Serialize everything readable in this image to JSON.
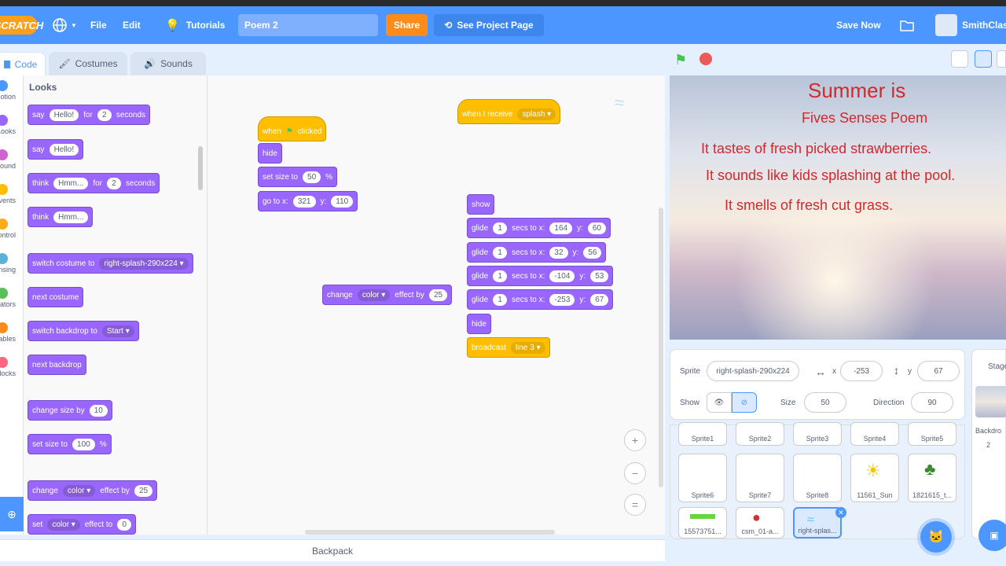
{
  "menu": {
    "logo": "SCRATCH",
    "file": "File",
    "edit": "Edit",
    "tutorials": "Tutorials",
    "project_title": "Poem 2",
    "share": "Share",
    "see_project": "See Project Page",
    "save_now": "Save Now",
    "username": "SmithClas"
  },
  "tabs": {
    "code": "Code",
    "costumes": "Costumes",
    "sounds": "Sounds"
  },
  "categories": [
    "Motion",
    "Looks",
    "Sound",
    "Events",
    "Control",
    "Sensing",
    "Operators",
    "Variables",
    "My Blocks"
  ],
  "category_colors": [
    "#4c97ff",
    "#9966ff",
    "#cf63cf",
    "#ffbf00",
    "#ffab19",
    "#5cb1d6",
    "#59c059",
    "#ff8c1a",
    "#ff6680"
  ],
  "palette": {
    "title": "Looks",
    "say_for": {
      "say": "say",
      "msg": "Hello!",
      "for": "for",
      "secs": "2",
      "seconds": "seconds"
    },
    "say": {
      "say": "say",
      "msg": "Hello!"
    },
    "think_for": {
      "think": "think",
      "msg": "Hmm...",
      "for": "for",
      "secs": "2",
      "seconds": "seconds"
    },
    "think": {
      "think": "think",
      "msg": "Hmm..."
    },
    "switch_costume": {
      "label": "switch costume to",
      "value": "right-splash-290x224"
    },
    "next_costume": "next costume",
    "switch_backdrop": {
      "label": "switch backdrop to",
      "value": "Start"
    },
    "next_backdrop": "next backdrop",
    "change_size": {
      "label": "change size by",
      "value": "10"
    },
    "set_size": {
      "label": "set size to",
      "value": "100",
      "unit": "%"
    },
    "change_effect": {
      "change": "change",
      "effect": "color",
      "by": "effect by",
      "value": "25"
    },
    "set_effect": {
      "set": "set",
      "effect": "color",
      "to": "effect to",
      "value": "0"
    }
  },
  "script1": {
    "when": "when",
    "clicked": "clicked",
    "hide": "hide",
    "set_size": "set size to",
    "size": "50",
    "pct": "%",
    "goto": "go to x:",
    "x": "321",
    "y_lbl": "y:",
    "y": "110"
  },
  "script2": {
    "when_receive": "when I receive",
    "message": "splash"
  },
  "script3": {
    "show": "show",
    "glides": [
      {
        "glide": "glide",
        "secs": "1",
        "to": "secs to x:",
        "x": "164",
        "y_lbl": "y:",
        "y": "60"
      },
      {
        "glide": "glide",
        "secs": "1",
        "to": "secs to x:",
        "x": "32",
        "y_lbl": "y:",
        "y": "56"
      },
      {
        "glide": "glide",
        "secs": "1",
        "to": "secs to x:",
        "x": "-104",
        "y_lbl": "y:",
        "y": "53"
      },
      {
        "glide": "glide",
        "secs": "1",
        "to": "secs to x:",
        "x": "-253",
        "y_lbl": "y:",
        "y": "67"
      }
    ],
    "hide": "hide",
    "broadcast": "broadcast",
    "broadcast_msg": "line 3"
  },
  "loose_block": {
    "change": "change",
    "effect": "color",
    "by": "effect by",
    "value": "25"
  },
  "zoom": {
    "in": "+",
    "out": "−",
    "reset": "="
  },
  "backpack": "Backpack",
  "stage": {
    "title": "Summer is",
    "subtitle": "Fives Senses Poem",
    "line1": "It tastes of fresh picked strawberries.",
    "line2": "It sounds like kids splashing at the pool.",
    "line3": "It smells of fresh cut grass."
  },
  "sprite_info": {
    "sprite_label": "Sprite",
    "sprite_name": "right-splash-290x224",
    "x_label": "x",
    "x": "-253",
    "y_label": "y",
    "y": "67",
    "show_label": "Show",
    "size_label": "Size",
    "size": "50",
    "direction_label": "Direction",
    "direction": "90"
  },
  "sprites": [
    "Sprite1",
    "Sprite2",
    "Sprite3",
    "Sprite4",
    "Sprite5",
    "Sprite6",
    "Sprite7",
    "Sprite8",
    "11561_Sun",
    "1821615_t...",
    "15573751...",
    "csm_01-a...",
    "right-splas..."
  ],
  "stage_pane": {
    "label": "Stage",
    "backdrops": "Backdro",
    "count": "2"
  }
}
